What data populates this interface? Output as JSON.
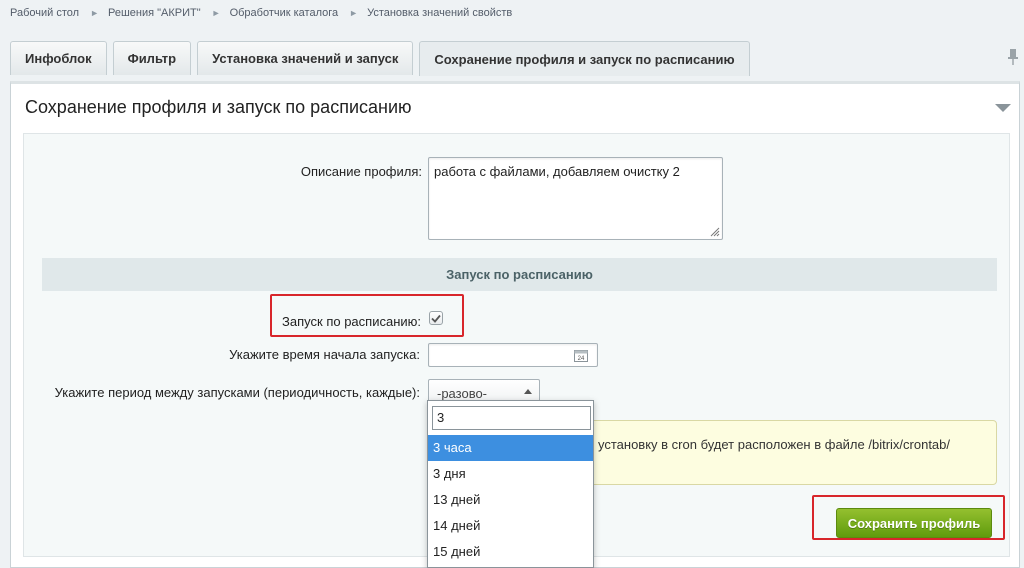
{
  "breadcrumb": [
    "Рабочий стол",
    "Решения \"АКРИТ\"",
    "Обработчик каталога",
    "Установка значений свойств"
  ],
  "tabs": [
    "Инфоблок",
    "Фильтр",
    "Установка значений и запуск",
    "Сохранение профиля и запуск по расписанию"
  ],
  "panel": {
    "title": "Сохранение профиля и запуск по расписанию",
    "description_label": "Описание профиля:",
    "description_value": "работа с файлами, добавляем очистку 2",
    "section_title": "Запуск по расписанию",
    "schedule_label": "Запуск по расписанию:",
    "schedule_checked": true,
    "start_time_label": "Укажите время начала запуска:",
    "start_time_value": "",
    "period_label": "Укажите период между запусками (периодичность, каждые):",
    "period_value": "-разово-",
    "notice_text": "установку в cron будет расположен в файле /bitrix/crontab/",
    "save_label": "Сохранить профиль"
  },
  "dropdown": {
    "search_value": "3",
    "options": [
      "3 часа",
      "3 дня",
      "13 дней",
      "14 дней",
      "15 дней"
    ],
    "highlighted": "3 часа"
  },
  "colors": {
    "accent_red": "#d8262b",
    "save_green": "#6fa814",
    "highlight_blue": "#3d8fe0"
  }
}
